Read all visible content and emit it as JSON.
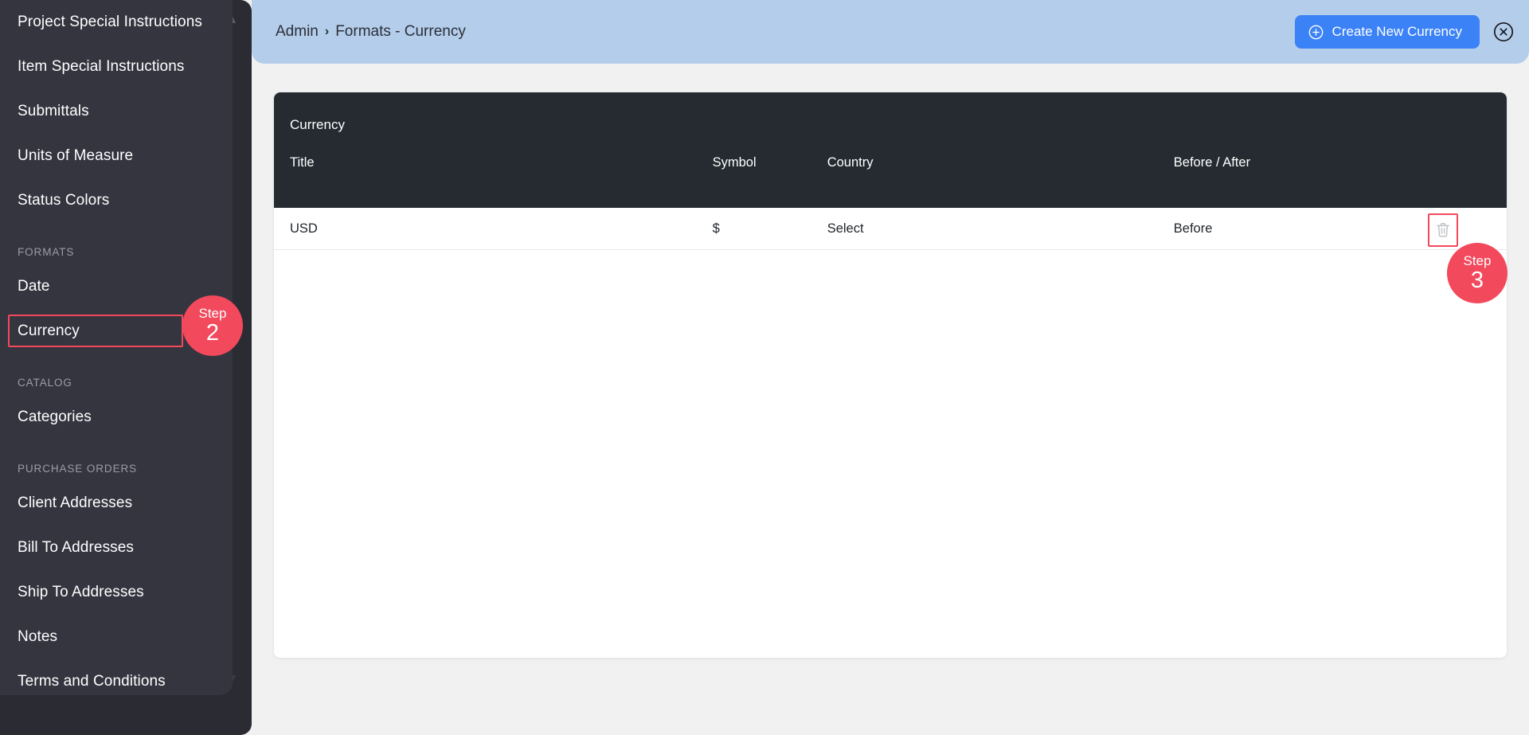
{
  "sidebar": {
    "items": [
      {
        "type": "link",
        "label": "Project Special Instructions",
        "name": "sidebar-item-project-special-instructions"
      },
      {
        "type": "link",
        "label": "Item Special Instructions",
        "name": "sidebar-item-item-special-instructions"
      },
      {
        "type": "link",
        "label": "Submittals",
        "name": "sidebar-item-submittals"
      },
      {
        "type": "link",
        "label": "Units of Measure",
        "name": "sidebar-item-units-of-measure"
      },
      {
        "type": "link",
        "label": "Status Colors",
        "name": "sidebar-item-status-colors"
      },
      {
        "type": "section",
        "label": "FORMATS",
        "name": "sidebar-section-formats"
      },
      {
        "type": "link",
        "label": "Date",
        "name": "sidebar-item-date"
      },
      {
        "type": "link",
        "label": "Currency",
        "name": "sidebar-item-currency",
        "highlighted": true
      },
      {
        "type": "section",
        "label": "CATALOG",
        "name": "sidebar-section-catalog"
      },
      {
        "type": "link",
        "label": "Categories",
        "name": "sidebar-item-categories"
      },
      {
        "type": "section",
        "label": "PURCHASE ORDERS",
        "name": "sidebar-section-purchase-orders"
      },
      {
        "type": "link",
        "label": "Client Addresses",
        "name": "sidebar-item-client-addresses"
      },
      {
        "type": "link",
        "label": "Bill To Addresses",
        "name": "sidebar-item-bill-to-addresses"
      },
      {
        "type": "link",
        "label": "Ship To Addresses",
        "name": "sidebar-item-ship-to-addresses"
      },
      {
        "type": "link",
        "label": "Notes",
        "name": "sidebar-item-notes"
      },
      {
        "type": "link",
        "label": "Terms and Conditions",
        "name": "sidebar-item-terms-and-conditions"
      }
    ]
  },
  "topbar": {
    "breadcrumb": {
      "root": "Admin",
      "separator": "›",
      "current": "Formats - Currency"
    },
    "create_button_label": "Create New Currency",
    "create_button_icon": "plus-circle-icon",
    "close_button_icon": "close-circle-icon",
    "background_color": "#B4CDEB",
    "create_button_color": "#3B82F6"
  },
  "card": {
    "title": "Currency",
    "header_background": "#252B31",
    "columns": [
      {
        "key": "title",
        "label": "Title"
      },
      {
        "key": "symbol",
        "label": "Symbol"
      },
      {
        "key": "country",
        "label": "Country"
      },
      {
        "key": "before_after",
        "label": "Before / After"
      }
    ],
    "rows": [
      {
        "title": "USD",
        "symbol": "$",
        "country": "Select",
        "before_after": "Before",
        "delete_icon": "trash-icon"
      }
    ]
  },
  "annotations": {
    "color": "#F2495C",
    "badges": [
      {
        "id": "step-2",
        "word": "Step",
        "number": "2",
        "target": "sidebar-item-currency"
      },
      {
        "id": "step-3",
        "word": "Step",
        "number": "3",
        "target": "row-delete-button"
      }
    ]
  }
}
